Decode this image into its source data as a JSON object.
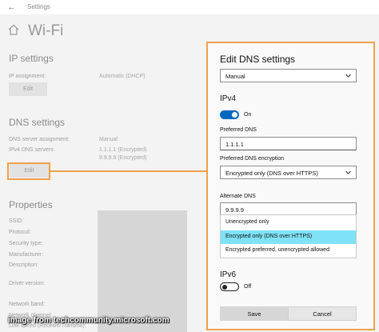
{
  "window": {
    "app_title": "Settings",
    "page_title": "Wi-Fi"
  },
  "ip_settings": {
    "heading": "IP settings",
    "assignment_label": "IP assignment:",
    "assignment_value": "Automatic (DHCP)",
    "edit_label": "Edit"
  },
  "dns_settings": {
    "heading": "DNS settings",
    "server_assignment_label": "DNS server assignment:",
    "server_assignment_value": "Manual",
    "ipv4_servers_label": "IPv4 DNS servers:",
    "ipv4_server_1": "1.1.1.1 (Encrypted)",
    "ipv4_server_2": "9.9.9.9 (Encrypted)",
    "edit_label": "Edit"
  },
  "properties": {
    "heading": "Properties",
    "labels": [
      "SSID:",
      "Protocol:",
      "Security type:",
      "Manufacturer:",
      "Description:",
      "Driver version:",
      "Network band:",
      "Network channel:",
      "Link speed (Receive/Transmit):"
    ]
  },
  "watermark": "image from techcommunity.microsoft.com",
  "dialog": {
    "title": "Edit DNS settings",
    "mode_value": "Manual",
    "ipv4": {
      "heading": "IPv4",
      "toggle_state": "On",
      "preferred_dns_label": "Preferred DNS",
      "preferred_dns_value": "1.1.1.1",
      "preferred_encryption_label": "Preferred DNS encryption",
      "preferred_encryption_value": "Encrypted only (DNS over HTTPS)",
      "alternate_dns_label": "Alternate DNS",
      "alternate_dns_value": "9.9.9.9",
      "encryption_options": [
        "Unencrypted only",
        "Encrypted only (DNS over HTTPS)",
        "Encrypted preferred, unencrypted allowed"
      ],
      "selected_option": "Encrypted only (DNS over HTTPS)"
    },
    "ipv6": {
      "heading": "IPv6",
      "toggle_state": "Off"
    },
    "save_label": "Save",
    "cancel_label": "Cancel"
  },
  "colors": {
    "accent": "#0067c0",
    "highlight_border": "#f0a04b",
    "selected_option": "#7fe2f7"
  },
  "icons": [
    "back-arrow-icon",
    "home-icon",
    "chevron-down-icon"
  ]
}
